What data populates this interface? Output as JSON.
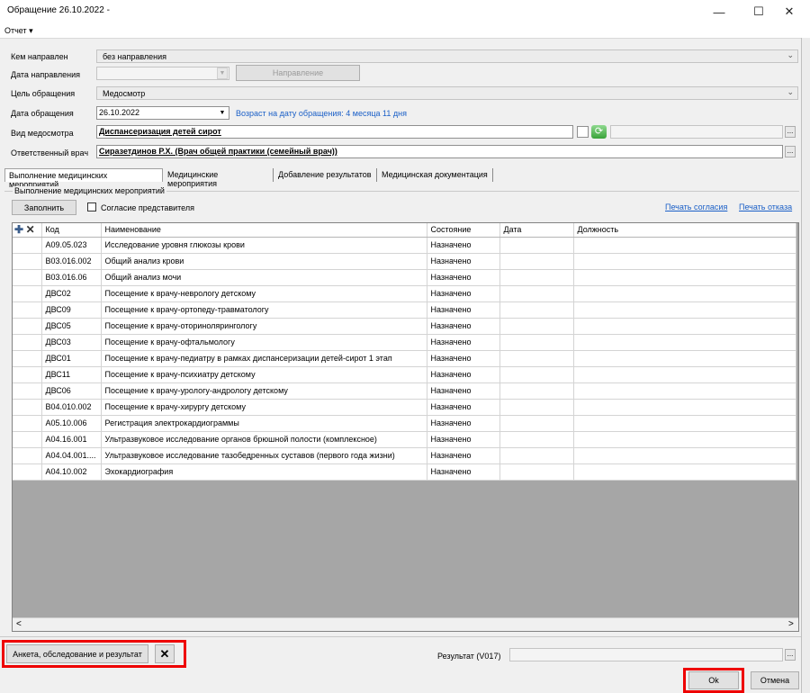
{
  "window": {
    "title": "Обращение 26.10.2022 -",
    "minimize": "—",
    "maximize": "☐",
    "close": "✕"
  },
  "menu": {
    "report": "Отчет ▾"
  },
  "form": {
    "referred_by_label": "Кем направлен",
    "referred_by_value": "без направления",
    "referral_date_label": "Дата направления",
    "referral_date_value": "",
    "referral_button": "Направление",
    "purpose_label": "Цель обращения",
    "purpose_value": "Медосмотр",
    "visit_date_label": "Дата обращения",
    "visit_date_value": "26.10.2022",
    "age_text": "Возраст на дату обращения: 4 месяца 11 дня",
    "exam_type_label": "Вид медосмотра",
    "exam_type_value": "Диспансеризация детей сирот",
    "doctor_label": "Ответственный врач",
    "doctor_value": "Сиразетдинов Р.Х. (Врач общей практики (семейный врач))"
  },
  "tabs": [
    {
      "label": "Выполнение медицинских мероприятий"
    },
    {
      "label": "Медицинские мероприятия"
    },
    {
      "label": "Добавление результатов"
    },
    {
      "label": "Медицинская документация"
    }
  ],
  "group": {
    "title": "Выполнение медицинских мероприятий",
    "fill_button": "Заполнить",
    "consent_label": "Согласие представителя",
    "print_consent": "Печать согласия",
    "print_refusal": "Печать отказа"
  },
  "table": {
    "columns": [
      "Код",
      "Наименование",
      "Состояние",
      "Дата",
      "Должность"
    ],
    "rows": [
      [
        "A09.05.023",
        "Исследование уровня глюкозы крови",
        "Назначено",
        "",
        ""
      ],
      [
        "B03.016.002",
        "Общий анализ крови",
        "Назначено",
        "",
        ""
      ],
      [
        "B03.016.06",
        "Общий анализ мочи",
        "Назначено",
        "",
        ""
      ],
      [
        "ДВС02",
        "Посещение к врачу-неврологу детскому",
        "Назначено",
        "",
        ""
      ],
      [
        "ДВС09",
        "Посещение к врачу-ортопеду-травматологу",
        "Назначено",
        "",
        ""
      ],
      [
        "ДВС05",
        "Посещение к врачу-оторинолярингологу",
        "Назначено",
        "",
        ""
      ],
      [
        "ДВС03",
        "Посещение к врачу-офтальмологу",
        "Назначено",
        "",
        ""
      ],
      [
        "ДВС01",
        "Посещение к врачу-педиатру в рамках диспансеризации детей-сирот 1 этап",
        "Назначено",
        "",
        ""
      ],
      [
        "ДВС11",
        "Посещение к врачу-психиатру детскому",
        "Назначено",
        "",
        ""
      ],
      [
        "ДВС06",
        "Посещение к врачу-урологу-андрологу детскому",
        "Назначено",
        "",
        ""
      ],
      [
        "B04.010.002",
        "Посещение к врачу-хирургу детскому",
        "Назначено",
        "",
        ""
      ],
      [
        "A05.10.006",
        "Регистрация электрокардиограммы",
        "Назначено",
        "",
        ""
      ],
      [
        "A04.16.001",
        "Ультразвуковое исследование органов брюшной полости (комплексное)",
        "Назначено",
        "",
        ""
      ],
      [
        "A04.04.001....",
        "Ультразвуковое исследование тазобедренных суставов (первого года жизни)",
        "Назначено",
        "",
        ""
      ],
      [
        "A04.10.002",
        "Эхокардиография",
        "Назначено",
        "",
        ""
      ]
    ]
  },
  "bottom": {
    "survey_button": "Анкета, обследование и результат",
    "result_label": "Результат (V017)",
    "ok_button": "Ok",
    "cancel_button": "Отмена"
  },
  "colors": {
    "highlight_border": "#ee0000",
    "link": "#1a5fc7",
    "grid_empty": "#a6a6a6"
  }
}
